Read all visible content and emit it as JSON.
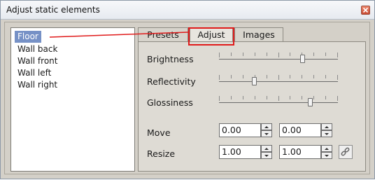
{
  "window": {
    "title": "Adjust static elements",
    "close_icon": "close-icon"
  },
  "list": {
    "items": [
      {
        "label": "Floor",
        "selected": true
      },
      {
        "label": "Wall back",
        "selected": false
      },
      {
        "label": "Wall front",
        "selected": false
      },
      {
        "label": "Wall left",
        "selected": false
      },
      {
        "label": "Wall right",
        "selected": false
      }
    ]
  },
  "tabs": [
    {
      "label": "Presets"
    },
    {
      "label": "Adjust",
      "active": true
    },
    {
      "label": "Images"
    }
  ],
  "adjust": {
    "brightness": {
      "label": "Brightness",
      "value": 0.71
    },
    "reflectivity": {
      "label": "Reflectivity",
      "value": 0.29
    },
    "glossiness": {
      "label": "Glossiness",
      "value": 0.78
    },
    "move": {
      "label": "Move",
      "x": "0.00",
      "y": "0.00"
    },
    "resize": {
      "label": "Resize",
      "x": "1.00",
      "y": "1.00",
      "link_icon": "link-icon"
    }
  },
  "colors": {
    "highlight": "#e01b1b",
    "selection": "#7691c6"
  }
}
